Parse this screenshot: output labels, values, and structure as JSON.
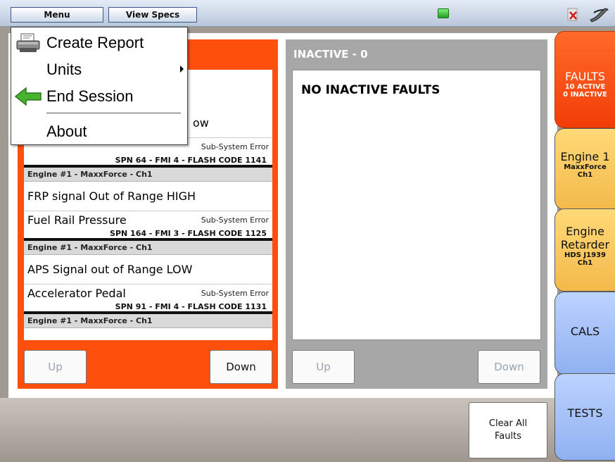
{
  "topbar": {
    "menu_label": "Menu",
    "view_specs_label": "View Specs",
    "icons": [
      "status-led-icon",
      "close-x-icon",
      "wrench-tool-icon"
    ]
  },
  "menu": {
    "items": [
      {
        "label": "Create Report",
        "icon": "printer-icon"
      },
      {
        "label": "Units",
        "submenu": true
      },
      {
        "label": "End Session",
        "icon": "green-back-arrow-icon"
      },
      {
        "label": "About"
      }
    ]
  },
  "active_panel": {
    "faults": [
      {
        "partial_desc": "ow",
        "partial_sub": "Sub-System Error",
        "codes": "SPN 64 - FMI 4 - FLASH CODE 1141"
      },
      {
        "group": "Engine #1 - MaxxForce - Ch1",
        "description": "FRP signal Out of Range HIGH",
        "component": "Fuel Rail Pressure",
        "subsystem": "Sub-System Error",
        "codes": "SPN 164 - FMI 3 - FLASH CODE 1125"
      },
      {
        "group": "Engine #1 - MaxxForce - Ch1",
        "description": "APS Signal out of Range LOW",
        "component": "Accelerator Pedal",
        "subsystem": "Sub-System Error",
        "codes": "SPN 91 - FMI 4 - FLASH CODE 1131"
      },
      {
        "group": "Engine #1 - MaxxForce - Ch1"
      }
    ],
    "up_label": "Up",
    "down_label": "Down"
  },
  "inactive_panel": {
    "title": "INACTIVE - 0",
    "empty_message": "NO INACTIVE FAULTS",
    "up_label": "Up",
    "down_label": "Down"
  },
  "actions": {
    "clear_all_faults": "Clear All Faults"
  },
  "tabs": [
    {
      "title": "FAULTS",
      "sub": [
        "10 ACTIVE",
        "0 INACTIVE"
      ],
      "selected": true,
      "color": "#f44a10"
    },
    {
      "title": "Engine 1",
      "sub": [
        "MaxxForce",
        "Ch1"
      ],
      "color": "#f8c75a"
    },
    {
      "title_lines": [
        "Engine",
        "Retarder"
      ],
      "sub": [
        "HDS J1939",
        "Ch1"
      ],
      "color": "#f8c75a"
    },
    {
      "title": "CALS",
      "color": "#a2bff5"
    },
    {
      "title": "TESTS",
      "color": "#a2bff5"
    }
  ],
  "colors": {
    "active_panel": "#ff4f0d",
    "inactive_panel": "#a7a7a7",
    "group_header": "#d9d9d9"
  }
}
